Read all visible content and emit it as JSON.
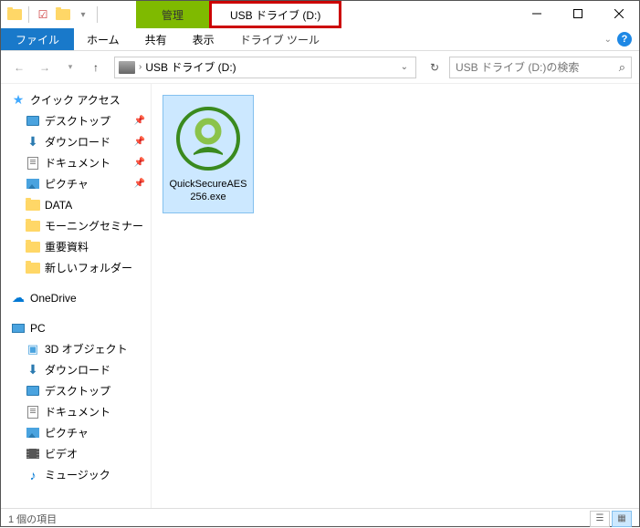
{
  "titlebar": {
    "ctx_category": "管理",
    "ctx_title": "USB ドライブ (D:)"
  },
  "ribbon": {
    "file": "ファイル",
    "home": "ホーム",
    "share": "共有",
    "view": "表示",
    "ctx_tool": "ドライブ ツール"
  },
  "address": {
    "path": "USB ドライブ (D:)"
  },
  "search": {
    "placeholder": "USB ドライブ (D:)の検索"
  },
  "sidebar": {
    "quick_access": "クイック アクセス",
    "desktop": "デスクトップ",
    "downloads": "ダウンロード",
    "documents": "ドキュメント",
    "pictures": "ピクチャ",
    "data": "DATA",
    "morning": "モーニングセミナー",
    "important": "重要資料",
    "newfolder": "新しいフォルダー",
    "onedrive": "OneDrive",
    "pc": "PC",
    "obj3d": "3D オブジェクト",
    "downloads2": "ダウンロード",
    "desktop2": "デスクトップ",
    "documents2": "ドキュメント",
    "pictures2": "ピクチャ",
    "videos": "ビデオ",
    "music": "ミュージック"
  },
  "files": {
    "item1": "QuickSecureAES256.exe"
  },
  "status": {
    "count": "1 個の項目"
  }
}
